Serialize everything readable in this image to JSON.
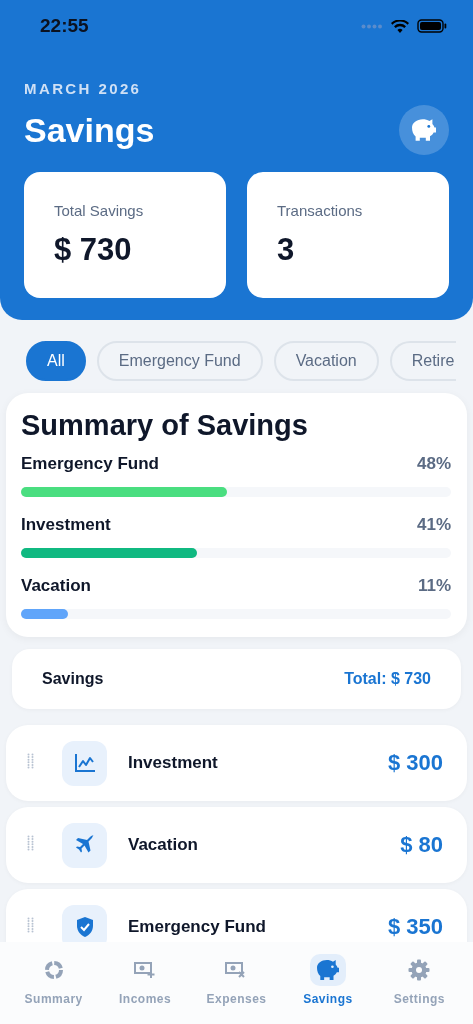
{
  "status_bar": {
    "time": "22:55"
  },
  "header": {
    "subtitle": "MARCH 2026",
    "title": "Savings"
  },
  "stats": [
    {
      "label": "Total Savings",
      "value": "$ 730"
    },
    {
      "label": "Transactions",
      "value": "3"
    }
  ],
  "filters": [
    {
      "label": "All",
      "selected": true
    },
    {
      "label": "Emergency Fund",
      "selected": false
    },
    {
      "label": "Vacation",
      "selected": false
    },
    {
      "label": "Retire",
      "selected": false
    }
  ],
  "summary": {
    "title": "Summary of Savings",
    "items": [
      {
        "name": "Emergency Fund",
        "percent": "48%",
        "level": 0.48,
        "color": "#4ade80"
      },
      {
        "name": "Investment",
        "percent": "41%",
        "level": 0.41,
        "color": "#10b981"
      },
      {
        "name": "Vacation",
        "percent": "11%",
        "level": 0.11,
        "color": "#60a5fa"
      }
    ]
  },
  "savings_header": {
    "title": "Savings",
    "total": "Total: $ 730"
  },
  "savings": [
    {
      "name": "Investment",
      "amount": "$ 300"
    },
    {
      "name": "Vacation",
      "amount": "$ 80"
    },
    {
      "name": "Emergency Fund",
      "amount": "$ 350"
    }
  ],
  "tabs": [
    {
      "label": "Summary",
      "selected": false
    },
    {
      "label": "Incomes",
      "selected": false
    },
    {
      "label": "Expenses",
      "selected": false
    },
    {
      "label": "Savings",
      "selected": true
    },
    {
      "label": "Settings",
      "selected": false
    }
  ]
}
